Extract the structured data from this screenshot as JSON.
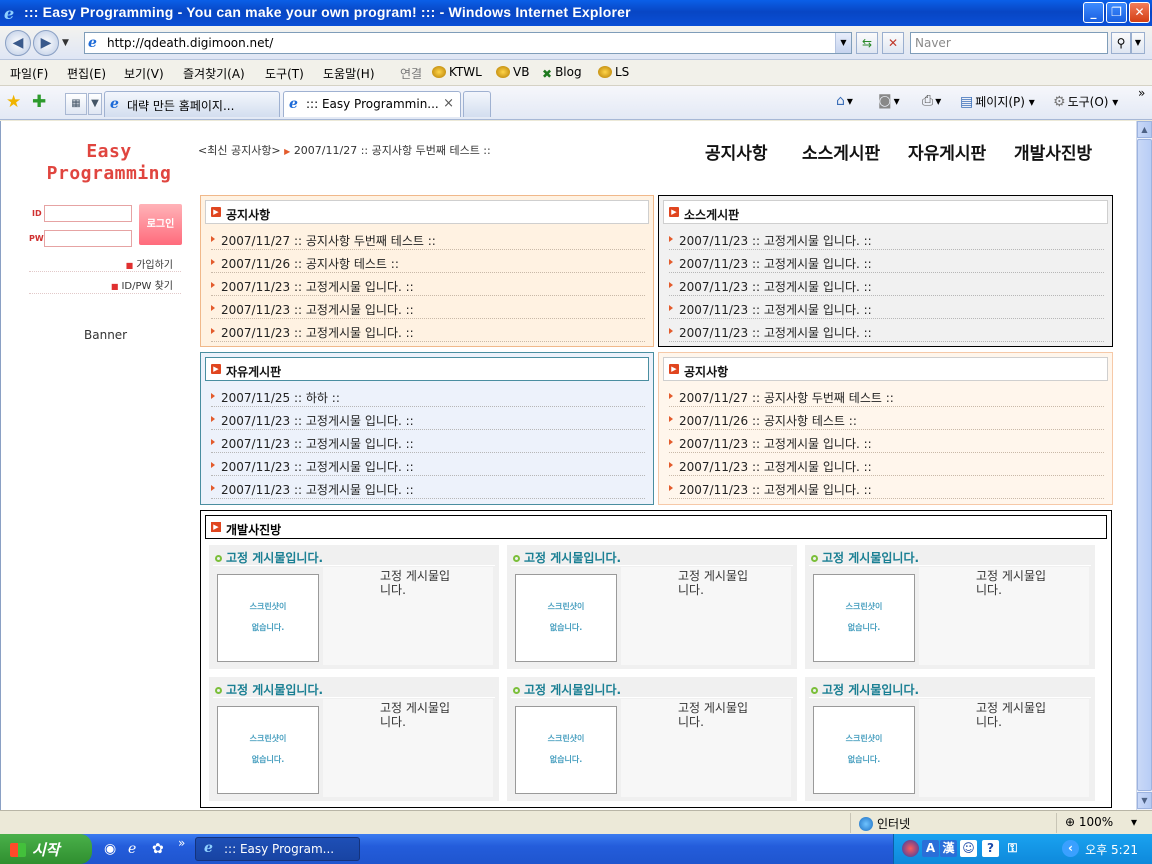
{
  "window": {
    "title": "::: Easy Programming - You can make your own program! ::: - Windows Internet Explorer"
  },
  "address": {
    "url": "http://qdeath.digimoon.net/",
    "search_placeholder": "Naver"
  },
  "menu": {
    "items": [
      "파일(F)",
      "편집(E)",
      "보기(V)",
      "즐겨찾기(A)",
      "도구(T)",
      "도움말(H)"
    ],
    "links_label": "연결",
    "links": [
      "KTWL",
      "VB",
      "Blog",
      "LS"
    ]
  },
  "tabs": {
    "items": [
      {
        "label": "대략 만든 홈페이지..."
      },
      {
        "label": "::: Easy Programmin..."
      }
    ],
    "close": "×",
    "page_label": "페이지(P)",
    "tools_label": "도구(O)",
    "more": "»"
  },
  "site": {
    "logo_line1": "Easy",
    "logo_line2": "Programming",
    "login": {
      "id_label": "ID",
      "pw_label": "PW",
      "button": "로그인",
      "join": "가입하기",
      "find": "ID/PW 찾기"
    },
    "banner": "Banner",
    "latest_notice_prefix": "<최신 공지사항>",
    "latest_notice": "2007/11/27 :: 공지사항 두번째 테스트 ::",
    "nav": [
      "공지사항",
      "소스게시판",
      "자유게시판",
      "개발사진방"
    ],
    "boards": [
      {
        "title": "공지사항",
        "rows": [
          "2007/11/27 :: 공지사항 두번째 테스트 ::",
          "2007/11/26 :: 공지사항 테스트 ::",
          "2007/11/23 :: 고정게시물 입니다. ::",
          "2007/11/23 :: 고정게시물 입니다. ::",
          "2007/11/23 :: 고정게시물 입니다. ::"
        ]
      },
      {
        "title": "소스게시판",
        "rows": [
          "2007/11/23 :: 고정게시물 입니다. ::",
          "2007/11/23 :: 고정게시물 입니다. ::",
          "2007/11/23 :: 고정게시물 입니다. ::",
          "2007/11/23 :: 고정게시물 입니다. ::",
          "2007/11/23 :: 고정게시물 입니다. ::"
        ]
      },
      {
        "title": "자유게시판",
        "rows": [
          "2007/11/25 :: 하하 ::",
          "2007/11/23 :: 고정게시물 입니다. ::",
          "2007/11/23 :: 고정게시물 입니다. ::",
          "2007/11/23 :: 고정게시물 입니다. ::",
          "2007/11/23 :: 고정게시물 입니다. ::"
        ]
      },
      {
        "title": "공지사항",
        "rows": [
          "2007/11/27 :: 공지사항 두번째 테스트 ::",
          "2007/11/26 :: 공지사항 테스트 ::",
          "2007/11/23 :: 고정게시물 입니다. ::",
          "2007/11/23 :: 고정게시물 입니다. ::",
          "2007/11/23 :: 고정게시물 입니다. ::"
        ]
      }
    ],
    "gallery": {
      "title": "개발사진방",
      "card_title": "고정 게시물입니다.",
      "thumb_line1": "스크린샷이",
      "thumb_line2": "없습니다.",
      "desc_line1": "고정 게시물입",
      "desc_line2": "니다."
    }
  },
  "status": {
    "zone": "인터넷",
    "zoom": "100%"
  },
  "taskbar": {
    "start": "시작",
    "task": "::: Easy Program...",
    "clock": "오후 5:21",
    "ime_a": "A",
    "ime_han": "漢"
  }
}
